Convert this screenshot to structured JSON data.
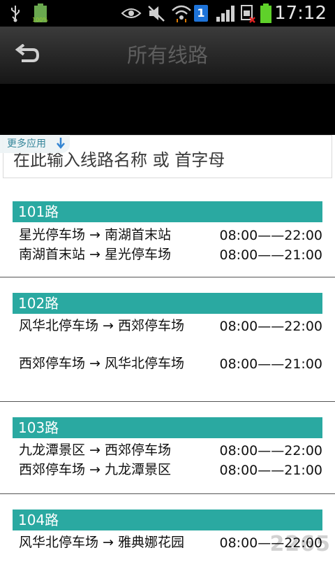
{
  "status_bar": {
    "time": "17:12",
    "battery_small_percent": "100%",
    "notification_badge": "1",
    "icons": [
      "usb-icon",
      "battery-full-icon",
      "eye-icon",
      "mute-icon",
      "wifi-icon",
      "notification-icon",
      "signal-icon",
      "sim-icon",
      "battery-icon"
    ]
  },
  "header": {
    "title": "所有线路",
    "back_icon": "back-arrow-icon"
  },
  "overlay": {
    "more_apps_label": "更多应用"
  },
  "search": {
    "placeholder": "在此输入线路名称 或 首字母"
  },
  "routes": [
    {
      "name": "101路",
      "trips": [
        {
          "direction": "星光停车场 → 南湖首末站",
          "time": "08:00——22:00"
        },
        {
          "direction": "南湖首末站 → 星光停车场",
          "time": "08:00——21:00"
        }
      ]
    },
    {
      "name": "102路",
      "trips": [
        {
          "direction": "风华北停车场 → 西郊停车场",
          "time": "08:00——22:00"
        },
        {
          "direction": "西郊停车场 → 风华北停车场",
          "time": "08:00——21:00"
        }
      ]
    },
    {
      "name": "103路",
      "trips": [
        {
          "direction": "九龙潭景区 → 西郊停车场",
          "time": "08:00——22:00"
        },
        {
          "direction": "西郊停车场 → 九龙潭景区",
          "time": "08:00——21:00"
        }
      ]
    },
    {
      "name": "104路",
      "trips": [
        {
          "direction": "风华北停车场 → 雅典娜花园",
          "time": "08:00——22:00"
        }
      ]
    }
  ],
  "watermark": "2265"
}
